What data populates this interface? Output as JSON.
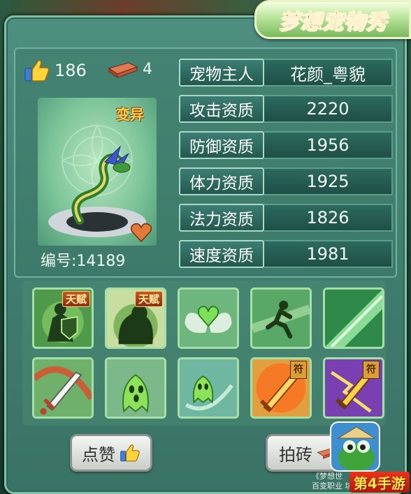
{
  "title": "梦想宠物秀",
  "likes": {
    "count": "186",
    "icon": "thumbs-up-icon"
  },
  "bricks": {
    "count": "4",
    "icon": "brick-icon"
  },
  "pet": {
    "tag": "变异",
    "id_label": "编号:14189"
  },
  "attributes": [
    {
      "label": "宠物主人",
      "value": "花颜_粤貌"
    },
    {
      "label": "攻击资质",
      "value": "2220"
    },
    {
      "label": "防御资质",
      "value": "1956"
    },
    {
      "label": "体力资质",
      "value": "1925"
    },
    {
      "label": "法力资质",
      "value": "1826"
    },
    {
      "label": "速度资质",
      "value": "1981"
    }
  ],
  "skills": [
    {
      "name": "skill-shield-warrior",
      "badge": "天赋"
    },
    {
      "name": "skill-beast",
      "badge": "天赋"
    },
    {
      "name": "skill-heart-wings",
      "badge": ""
    },
    {
      "name": "skill-dash",
      "badge": ""
    },
    {
      "name": "skill-green-burst",
      "badge": ""
    },
    {
      "name": "skill-sword",
      "badge": ""
    },
    {
      "name": "skill-ghost",
      "badge": ""
    },
    {
      "name": "skill-ghost-wind",
      "badge": ""
    },
    {
      "name": "skill-fire-sword",
      "badge": "符"
    },
    {
      "name": "skill-lightning-sword",
      "badge": "符"
    }
  ],
  "buttons": {
    "like": "点赞",
    "brick": "拍砖"
  },
  "caption": {
    "line1": "《梦想世",
    "line2": "百变职业 坑出不一样"
  },
  "watermark": "第4手游",
  "colors": {
    "panel": "#4f8f80",
    "title_text": "#d24f2a",
    "value_text": "#f2f7f4"
  }
}
